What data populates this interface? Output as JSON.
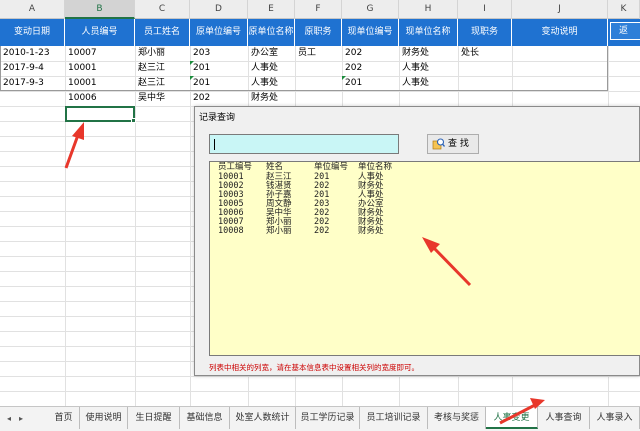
{
  "columns": [
    "A",
    "B",
    "C",
    "D",
    "E",
    "F",
    "G",
    "H",
    "I",
    "J",
    "K"
  ],
  "active_column": "B",
  "headers": [
    "变动日期",
    "人员编号",
    "员工姓名",
    "原单位编号",
    "原单位名称",
    "原职务",
    "现单位编号",
    "现单位名称",
    "现职务",
    "变动说明"
  ],
  "return_button": "返",
  "rows": [
    [
      "2010-1-23",
      "10007",
      "郑小丽",
      "203",
      "办公室",
      "员工",
      "202",
      "财务处",
      "处长",
      ""
    ],
    [
      "2017-9-4",
      "10001",
      "赵三江",
      "201",
      "人事处",
      "",
      "202",
      "人事处",
      "",
      ""
    ],
    [
      "2017-9-3",
      "10001",
      "赵三江",
      "201",
      "人事处",
      "",
      "201",
      "人事处",
      "",
      ""
    ],
    [
      "",
      "10006",
      "吴中华",
      "202",
      "财务处",
      "",
      "",
      "",
      "",
      ""
    ]
  ],
  "dialog": {
    "title": "记录查询",
    "search_value": "",
    "find_label": "查 找",
    "find_icon": "search-icon",
    "list_header": [
      "员工编号",
      "姓名",
      "单位编号",
      "单位名称"
    ],
    "list_rows": [
      [
        "10001",
        "赵三江",
        "201",
        "人事处"
      ],
      [
        "10002",
        "钱湛贤",
        "202",
        "财务处"
      ],
      [
        "10003",
        "孙子嘉",
        "201",
        "人事处"
      ],
      [
        "10005",
        "周文静",
        "203",
        "办公室"
      ],
      [
        "10006",
        "吴中华",
        "202",
        "财务处"
      ],
      [
        "10007",
        "郑小丽",
        "202",
        "财务处"
      ],
      [
        "10008",
        "郑小丽",
        "202",
        "财务处"
      ]
    ],
    "hint": "列表中相关的列宽，请在基本信息表中设置相关列的宽度即可。"
  },
  "tabs": [
    "首页",
    "使用说明",
    "生日提醒",
    "基础信息",
    "处室人数统计",
    "员工学历记录",
    "员工培训记录",
    "考核与奖惩",
    "人事变更",
    "人事查询",
    "人事录入"
  ],
  "active_tab": "人事变更",
  "colors": {
    "header_blue": "#1f72d1",
    "excel_green": "#217346",
    "list_bg": "#ffffc8",
    "input_bg": "#c9f6f6",
    "arrow_red": "#e8372b"
  }
}
